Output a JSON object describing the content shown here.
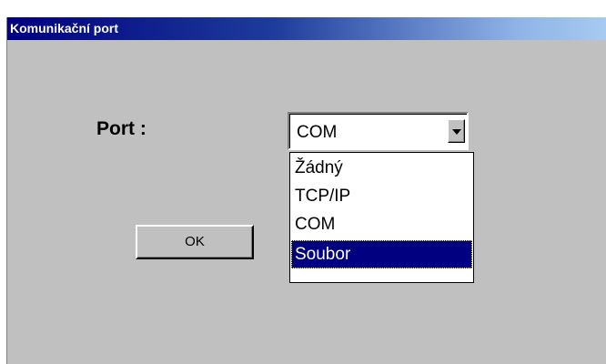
{
  "window": {
    "title": "Komunikační port"
  },
  "form": {
    "port_label": "Port :",
    "port_combo": {
      "value": "COM",
      "options": [
        "Žádný",
        "TCP/IP",
        "COM",
        "Soubor"
      ],
      "highlighted": "Soubor"
    },
    "ok_label": "OK"
  },
  "colors": {
    "title_bar_start": "#000080",
    "title_bar_end": "#a6caf0",
    "dialog_face": "#c0c0c0",
    "selection": "#000080"
  }
}
